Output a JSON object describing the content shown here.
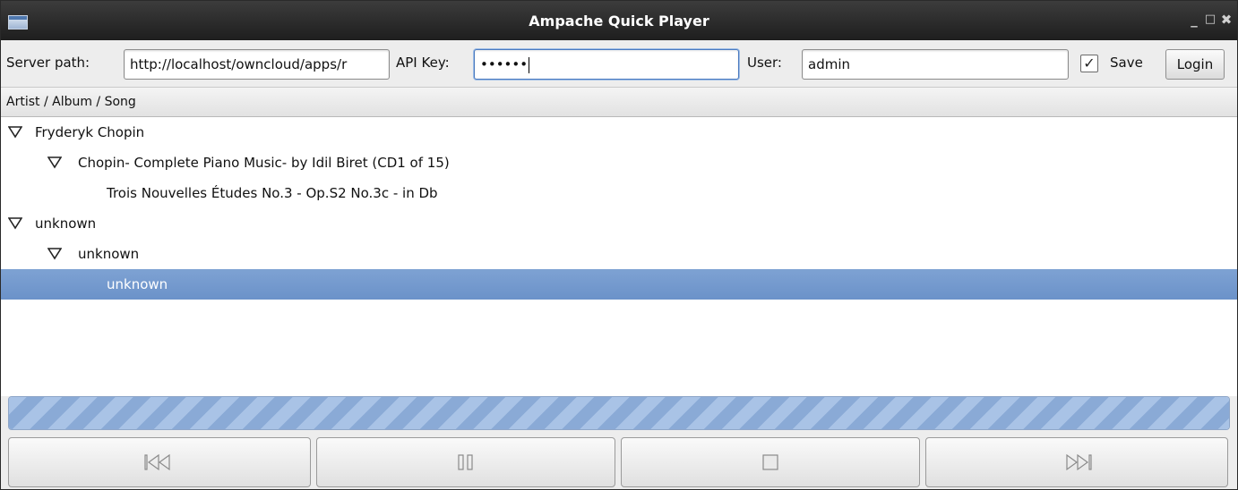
{
  "window": {
    "title": "Ampache Quick Player",
    "controls": {
      "minimize": "_",
      "maximize": "□",
      "close": "✖"
    }
  },
  "toolbar": {
    "server_label": "Server path:",
    "server_value": "http://localhost/owncloud/apps/r",
    "api_label": "API Key:",
    "api_value": "••••••",
    "user_label": "User:",
    "user_value": "admin",
    "save_checked": true,
    "save_check_glyph": "✓",
    "save_label": "Save",
    "login_label": "Login"
  },
  "tree": {
    "header": "Artist / Album / Song",
    "rows": [
      {
        "text": "Fryderyk Chopin",
        "level": 0,
        "expanded": true
      },
      {
        "text": "Chopin- Complete Piano Music- by Idil Biret (CD1 of 15)",
        "level": 1,
        "expanded": true
      },
      {
        "text": "Trois Nouvelles Études No.3 - Op.S2 No.3c - in Db",
        "level": 2
      },
      {
        "text": "unknown",
        "level": 0,
        "expanded": true
      },
      {
        "text": "unknown",
        "level": 1,
        "expanded": true
      },
      {
        "text": "unknown",
        "level": 2,
        "selected": true
      }
    ]
  },
  "progress": {
    "fraction": 1.0
  },
  "transport": [
    {
      "name": "previous-button",
      "icon": "skip-back-icon"
    },
    {
      "name": "pause-button",
      "icon": "pause-icon"
    },
    {
      "name": "stop-button",
      "icon": "stop-icon"
    },
    {
      "name": "next-button",
      "icon": "skip-forward-icon"
    }
  ],
  "colors": {
    "titlebar": "#2b2b2b",
    "selection": "#7399cf",
    "progress": "#9db8dd"
  }
}
